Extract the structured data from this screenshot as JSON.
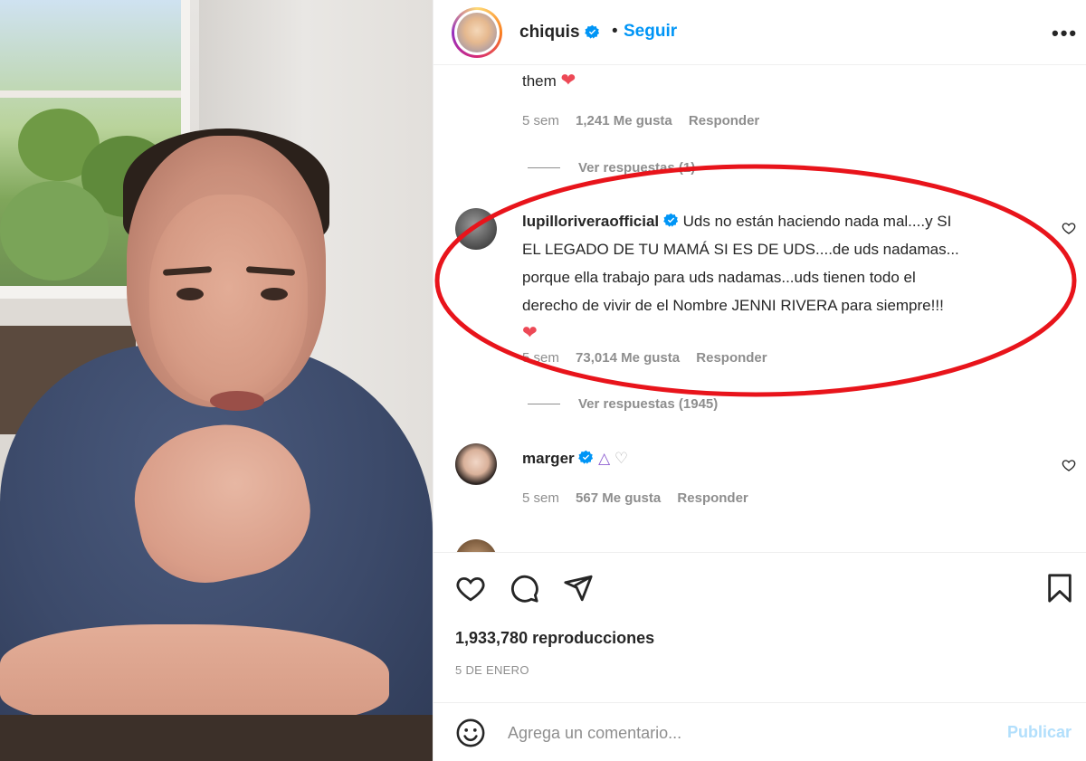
{
  "post": {
    "author": "chiquis",
    "follow_label": "Seguir",
    "separator": "•",
    "more_label": "•••"
  },
  "comments": {
    "prev_tail": "them",
    "prev_meta": {
      "age": "5 sem",
      "likes": "1,241 Me gusta",
      "reply": "Responder"
    },
    "prev_view_replies": "Ver respuestas (1)",
    "main": {
      "user": "lupilloriveraofficial",
      "line1": "Uds no están haciendo nada mal....y SI",
      "line2": "EL LEGADO DE TU MAMÁ SI ES DE UDS....de uds nadamas...",
      "line3": "porque ella trabajo para uds nadamas...uds tienen todo el",
      "line4": "derecho de vivir de el Nombre JENNI RIVERA para siempre!!!",
      "age": "5 sem",
      "likes": "73,014 Me gusta",
      "reply": "Responder",
      "view_replies": "Ver respuestas (1945)"
    },
    "next": {
      "user": "marger",
      "age": "5 sem",
      "likes": "567 Me gusta",
      "reply": "Responder"
    }
  },
  "stats": {
    "views": "1,933,780 reproducciones",
    "date": "5 DE ENERO"
  },
  "composer": {
    "placeholder": "Agrega un comentario...",
    "publish": "Publicar"
  },
  "colors": {
    "link_blue": "#0095f6",
    "verified_blue": "#0095f6",
    "heart_red": "#ed4956",
    "annotation_red": "#e8141b",
    "muted": "#8e8e8e"
  },
  "icons": [
    "heart-icon",
    "comment-icon",
    "share-icon",
    "bookmark-icon",
    "emoji-icon",
    "more-icon",
    "verified-icon"
  ]
}
